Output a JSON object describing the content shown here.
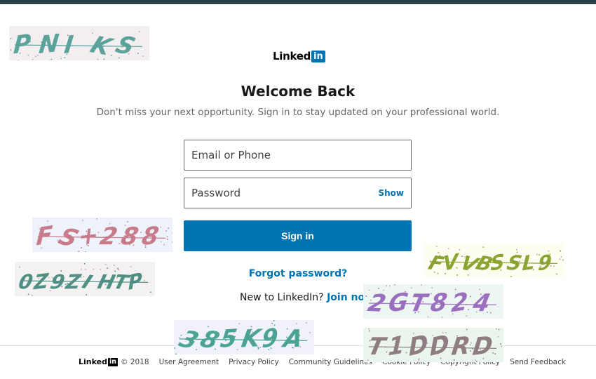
{
  "logo": {
    "word": "Linked",
    "in": "in"
  },
  "heading": {
    "title": "Welcome Back",
    "subtitle": "Don't miss your next opportunity. Sign in to stay updated on your professional world."
  },
  "form": {
    "email_placeholder": "Email or Phone",
    "password_placeholder": "Password",
    "show_label": "Show",
    "signin_label": "Sign in",
    "forgot_label": "Forgot password?",
    "new_prompt": "New to LinkedIn?",
    "join_label": "Join now"
  },
  "footer": {
    "logo_word": "Linked",
    "logo_in": "in",
    "copyright": "© 2018",
    "links": [
      "User Agreement",
      "Privacy Policy",
      "Community Guidelines",
      "Cookie Policy",
      "Copyright Policy",
      "Send Feedback"
    ]
  },
  "captchas": [
    {
      "text": "PNIKS",
      "color": "#5ba39a",
      "bg": "#f3eef0"
    },
    {
      "text": "FS+288",
      "color": "#c77b8b",
      "bg": "#eef2fa"
    },
    {
      "text": "0Z9ZIHTP",
      "color": "#4f8f84",
      "bg": "#f4f1f1"
    },
    {
      "text": "FVVBSSL9",
      "color": "#8aa331",
      "bg": "#fdfdf1"
    },
    {
      "text": "2GT824",
      "color": "#9a6fc0",
      "bg": "#eef6f1"
    },
    {
      "text": "385K9A",
      "color": "#4aa394",
      "bg": "#f1f1f9"
    },
    {
      "text": "T1DDRD",
      "color": "#8f7d82",
      "bg": "#eaf5ee"
    }
  ],
  "colors": {
    "brand": "#0073b1",
    "topbar": "#283e4a"
  }
}
